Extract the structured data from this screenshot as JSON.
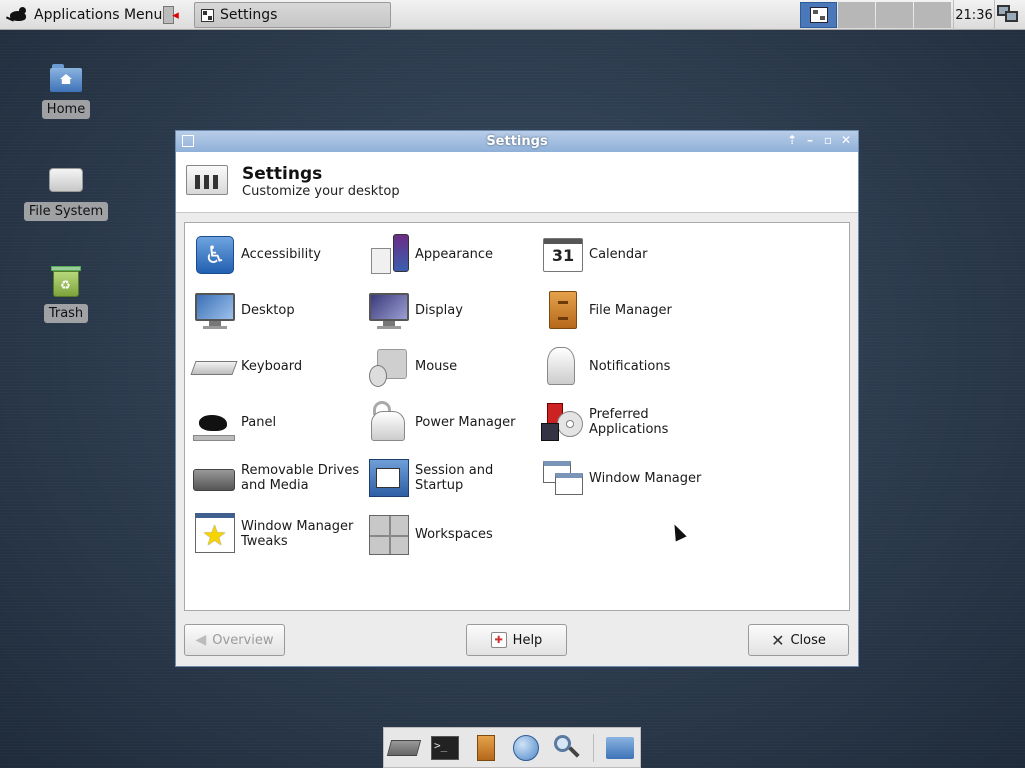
{
  "panel": {
    "apps_menu_label": "Applications Menu",
    "task_label": "Settings",
    "clock": "21:36"
  },
  "desktop": {
    "icons": [
      {
        "label": "Home"
      },
      {
        "label": "File System"
      },
      {
        "label": "Trash"
      }
    ]
  },
  "window": {
    "title": "Settings",
    "header_title": "Settings",
    "header_subtitle": "Customize your desktop",
    "items": {
      "accessibility": "Accessibility",
      "appearance": "Appearance",
      "calendar": "Calendar",
      "calendar_day": "31",
      "desktop": "Desktop",
      "display": "Display",
      "file_manager": "File Manager",
      "keyboard": "Keyboard",
      "mouse": "Mouse",
      "notifications": "Notifications",
      "panel": "Panel",
      "power_manager": "Power Manager",
      "preferred_applications": "Preferred Applications",
      "removable_drives": "Removable Drives and Media",
      "session_startup": "Session and Startup",
      "window_manager": "Window Manager",
      "window_manager_tweaks": "Window Manager Tweaks",
      "workspaces": "Workspaces"
    },
    "buttons": {
      "overview": "Overview",
      "help": "Help",
      "close": "Close"
    }
  },
  "colors": {
    "titlebar": "#8fb0d8",
    "desktop_bg": "#2a3a4e",
    "active_workspace": "#4a78b8"
  }
}
